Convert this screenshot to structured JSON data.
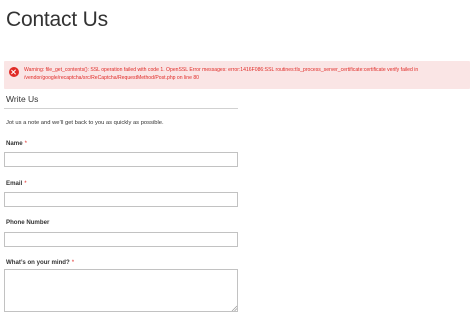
{
  "page": {
    "title": "Contact Us"
  },
  "error": {
    "icon": "error-circle-icon",
    "color": "#e02b27",
    "message": "Warning: file_get_contents(): SSL operation failed with code 1. OpenSSL Error messages: error:1416F086:SSL routines:tls_process_server_certificate:certificate verify failed in /vendor/google/recaptcha/src/ReCaptcha/RequestMethod/Post.php on line 80"
  },
  "form": {
    "section_title": "Write Us",
    "intro": "Jot us a note and we’ll get back to you as quickly as possible.",
    "required_mark": "*",
    "fields": {
      "name": {
        "label": "Name",
        "value": ""
      },
      "email": {
        "label": "Email",
        "value": ""
      },
      "phone": {
        "label": "Phone Number",
        "value": ""
      },
      "comment": {
        "label": "What’s on your mind?",
        "value": ""
      }
    }
  }
}
